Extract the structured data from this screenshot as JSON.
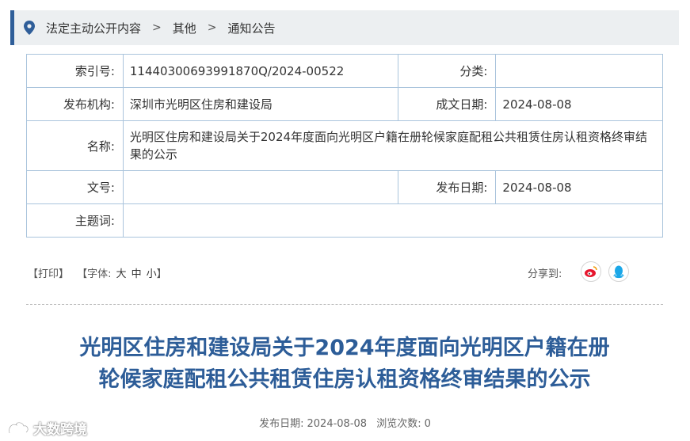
{
  "breadcrumb": {
    "items": [
      "法定主动公开内容",
      "其他",
      "通知公告"
    ],
    "separator": ">"
  },
  "info": {
    "index_label": "索引号:",
    "index_value": "11440300693991870Q/2024-00522",
    "category_label": "分类:",
    "category_value": "",
    "publisher_label": "发布机构:",
    "publisher_value": "深圳市光明区住房和建设局",
    "created_label": "成文日期:",
    "created_value": "2024-08-08",
    "name_label": "名称:",
    "name_value": "光明区住房和建设局关于2024年度面向光明区户籍在册轮候家庭配租公共租赁住房认租资格终审结果的公示",
    "docno_label": "文号:",
    "docno_value": "",
    "pubdate_label": "发布日期:",
    "pubdate_value": "2024-08-08",
    "keywords_label": "主题词:",
    "keywords_value": ""
  },
  "tools": {
    "print": "【打印】",
    "font_open": "【字体:",
    "sizes": [
      "大",
      "中",
      "小"
    ],
    "font_close": "】",
    "share_label": "分享到:",
    "share_icons": [
      "weibo-icon",
      "qq-icon"
    ]
  },
  "article": {
    "title_line1": "光明区住房和建设局关于2024年度面向光明区户籍在册",
    "title_line2": "轮候家庭配租公共租赁住房认租资格终审结果的公示",
    "pubdate_label": "发布日期:",
    "pubdate_value": "2024-08-08",
    "views_label": "浏览次数:",
    "views_value": "0"
  },
  "watermark": {
    "text": "大数跨境"
  },
  "colors": {
    "accent": "#2f5e99",
    "title": "#2d5d98",
    "border": "#aac4dc",
    "breadcrumb_bg": "#eceff1"
  }
}
